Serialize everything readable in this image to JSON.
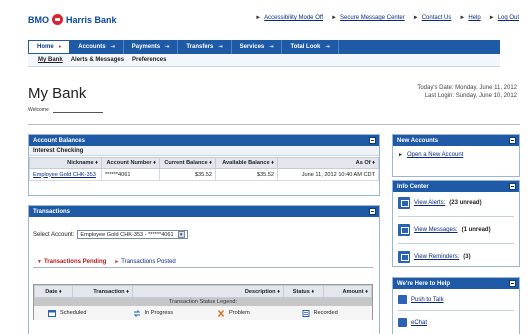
{
  "header": {
    "bank_name_left": "BMO",
    "bank_name_right": "Harris Bank",
    "top_links": [
      "Accessibility Mode Off",
      "Secure Message Center",
      "Contact Us",
      "Help",
      "Log Out"
    ]
  },
  "nav": {
    "tabs": [
      "Home",
      "Accounts",
      "Payments",
      "Transfers",
      "Services",
      "Total Look"
    ],
    "subtabs": [
      "My Bank",
      "Alerts & Messages",
      "Preferences"
    ]
  },
  "page": {
    "title": "My Bank",
    "welcome_label": "Welcome",
    "todays_date": "Today's Date: Monday, June 11, 2012",
    "last_login": "Last Login: Sunday, June 10, 2012"
  },
  "account_balances": {
    "header": "Account Balances",
    "group": "Interest Checking",
    "columns": [
      "Nickname ♦",
      "Account Number ♦",
      "Current Balance ♦",
      "Available Balance ♦",
      "As Of ♦"
    ],
    "row": {
      "nickname": "Employee Gold CHK-353",
      "account_number": "******4061",
      "current_balance": "$35.52",
      "available_balance": "$35.52",
      "as_of": "June 11, 2012 10:40 AM CDT"
    }
  },
  "transactions": {
    "header": "Transactions",
    "select_label": "Select Account:",
    "selected_account": "Employee Gold CHK-353 - ******4061",
    "tab_pending": "Transactions Pending",
    "tab_posted": "Transactions Posted",
    "columns": [
      "Date ♦",
      "Transaction ♦",
      "Description ♦",
      "Status ♦",
      "Amount ♦"
    ],
    "legend_title": "Transaction Status Legend:",
    "legend": [
      "Scheduled",
      "In Progress",
      "Problem",
      "Recorded"
    ]
  },
  "new_accounts": {
    "header": "New Accounts",
    "link": "Open a New Account"
  },
  "info_center": {
    "header": "Info Center",
    "items": [
      {
        "label": "View Alerts:",
        "count": "(23 unread)"
      },
      {
        "label": "View Messages:",
        "count": "(1 unread)"
      },
      {
        "label": "View Reminders:",
        "count": "(3)"
      }
    ]
  },
  "help": {
    "header": "We're Here to Help",
    "items": [
      "Push to Talk",
      "eChat"
    ]
  },
  "colors": {
    "brand_blue": "#1f5aa6",
    "brand_red": "#d9232e"
  }
}
